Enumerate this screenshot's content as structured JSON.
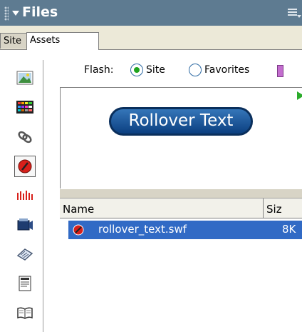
{
  "panel": {
    "title": "Files",
    "tabs": [
      "Site",
      "Assets"
    ],
    "active_tab": "Assets"
  },
  "sidebar": {
    "buttons": [
      "images-icon",
      "colors-icon",
      "urls-icon",
      "flash-icon",
      "shockwave-icon",
      "movies-icon",
      "scripts-icon",
      "templates-icon",
      "library-icon"
    ],
    "active": "flash-icon"
  },
  "flash_filter": {
    "label": "Flash:",
    "options": [
      "Site",
      "Favorites"
    ],
    "selected": "Site"
  },
  "preview": {
    "button_text": "Rollover Text"
  },
  "table": {
    "headers": [
      "Name",
      "Siz"
    ],
    "rows": [
      {
        "name": "rollover_text.swf",
        "size": "8K",
        "selected": true
      }
    ]
  },
  "colors": {
    "header_bg": "#5e7b91",
    "selection": "#316ac5",
    "rollover_button": "#1b5aa2"
  }
}
